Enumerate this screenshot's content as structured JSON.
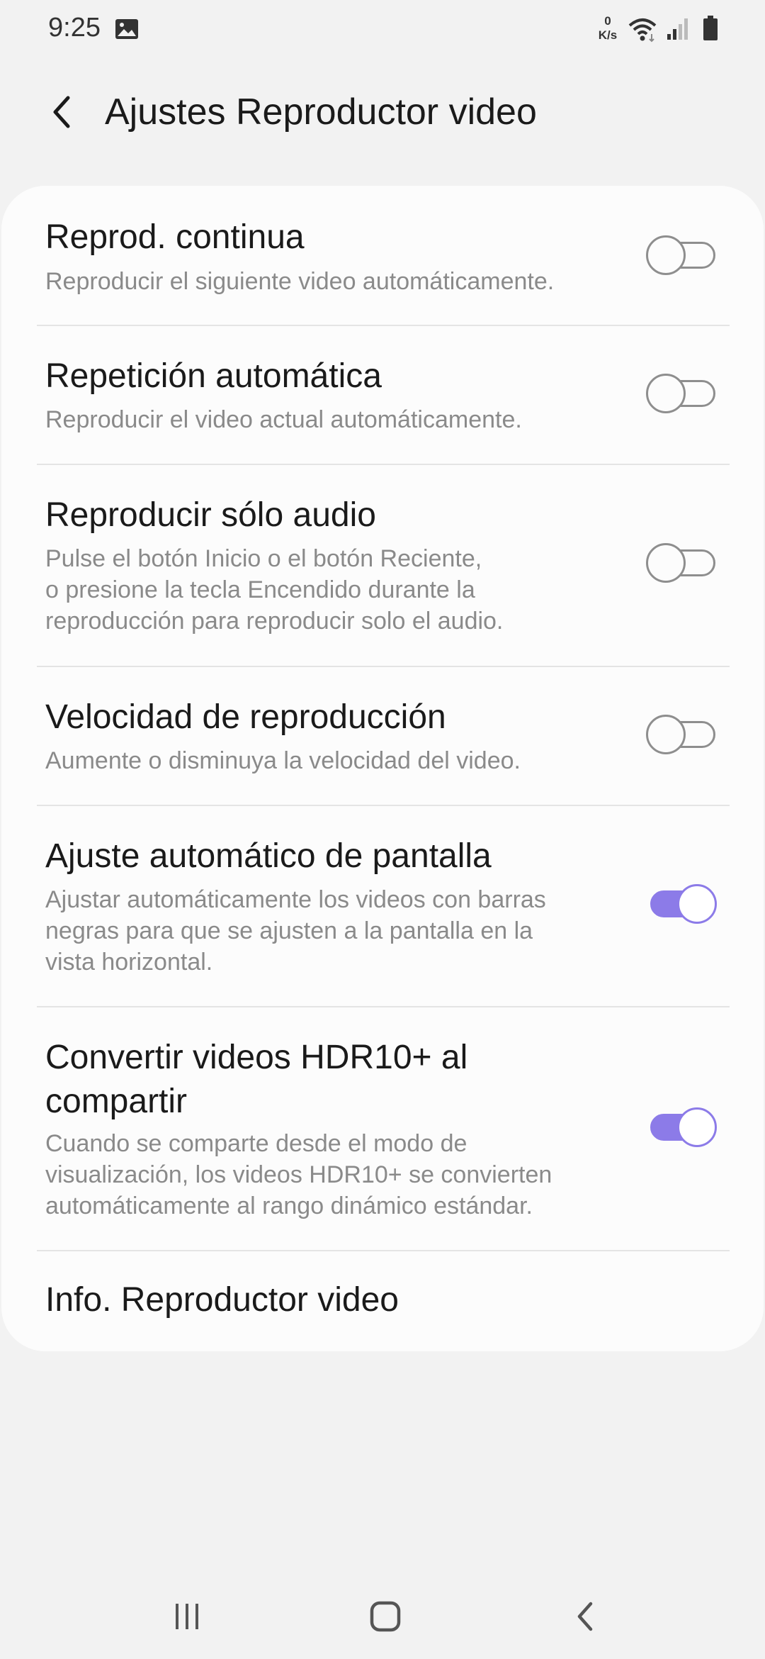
{
  "status_bar": {
    "time": "9:25",
    "net_speed_value": "0",
    "net_speed_unit": "K/s",
    "icons": [
      "gallery-icon",
      "wifi-icon",
      "signal-icon",
      "battery-icon"
    ]
  },
  "header": {
    "back_icon": "chevron-left-icon",
    "title": "Ajustes Reproductor video"
  },
  "settings": {
    "items": [
      {
        "title": "Reprod. continua",
        "subtitle": "Reproducir el siguiente video automáticamente.",
        "toggle": "off"
      },
      {
        "title": "Repetición automática",
        "subtitle": "Reproducir el video actual automáticamente.",
        "toggle": "off"
      },
      {
        "title": "Reproducir sólo audio",
        "subtitle_lines": [
          "Pulse el botón Inicio o el botón Reciente,",
          "o presione la tecla Encendido durante la",
          "reproducción para reproducir solo el audio."
        ],
        "toggle": "off"
      },
      {
        "title": "Velocidad de reproducción",
        "subtitle": "Aumente o disminuya la velocidad del video.",
        "toggle": "off"
      },
      {
        "title": "Ajuste automático de pantalla",
        "subtitle_lines": [
          "Ajustar automáticamente los videos con barras",
          "negras para que se ajusten a la pantalla en la",
          "vista horizontal."
        ],
        "toggle": "on"
      },
      {
        "title_lines": [
          "Convertir videos HDR10+ al",
          "compartir"
        ],
        "subtitle_lines": [
          "Cuando se comparte desde el modo de",
          "visualización, los videos HDR10+ se convierten",
          "automáticamente al rango dinámico estándar."
        ],
        "toggle": "on"
      },
      {
        "title": "Info. Reproductor video"
      }
    ]
  },
  "nav_bar": {
    "icons": [
      "recent-apps-icon",
      "home-icon",
      "back-icon"
    ]
  },
  "colors": {
    "accent": "#8c7be8",
    "background": "#f2f2f2",
    "card": "#fcfcfc"
  }
}
